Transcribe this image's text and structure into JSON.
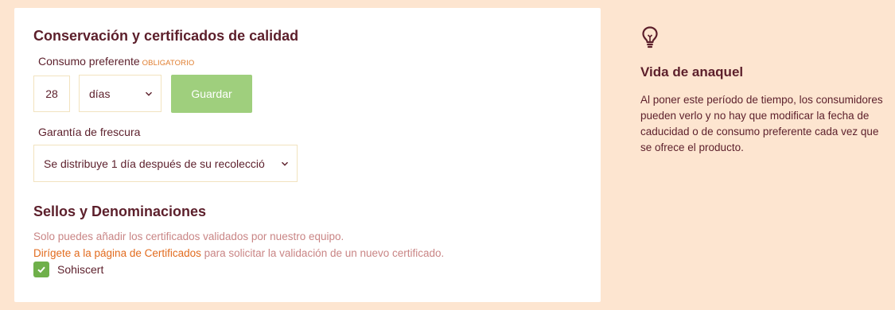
{
  "conservacion": {
    "title": "Conservación y certificados de calidad",
    "consumo_label": "Consumo preferente",
    "required_tag": "OBLIGATORIO",
    "consumo_value": "28",
    "unit_selected": "días",
    "save_label": "Guardar",
    "garantia_label": "Garantía de frescura",
    "garantia_selected": "Se distribuye 1 día después de su recolecció"
  },
  "sellos": {
    "title": "Sellos y Denominaciones",
    "info_text": "Solo puedes añadir los certificados validados por nuestro equipo.",
    "link_text": "Dirígete a la página de Certificados",
    "link_suffix": " para solicitar la validación de un nuevo certificado.",
    "certificates": [
      {
        "label": "Sohiscert",
        "checked": true
      }
    ]
  },
  "tip": {
    "icon": "lightbulb-icon",
    "title": "Vida de anaquel",
    "text": "Al poner este período de tiempo, los consumidores pueden verlo y no hay que modificar la fecha de caducidad o de consumo preferente cada vez que se ofrece el producto."
  },
  "colors": {
    "background": "#fde5d0",
    "text": "#5c1f2b",
    "accent": "#e26b1e",
    "button_green": "#9fcf7d",
    "checkbox_green": "#6fb04a"
  }
}
